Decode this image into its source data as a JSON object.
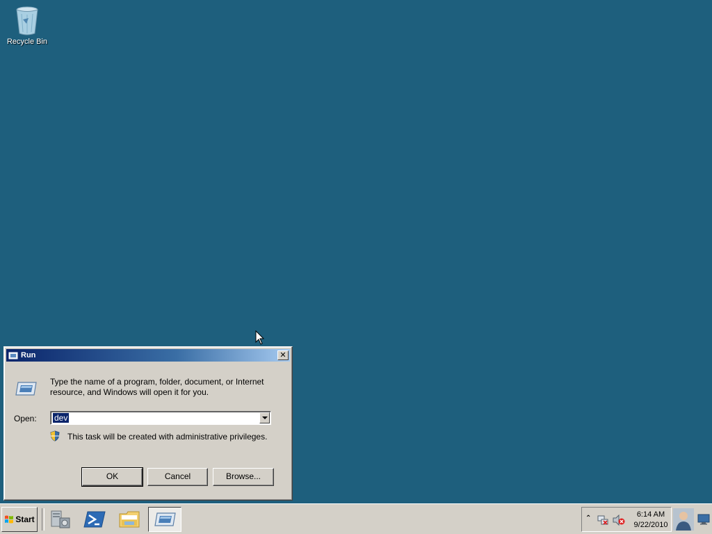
{
  "desktop": {
    "icons": [
      {
        "label": "Recycle Bin",
        "icon": "recycle-bin-icon"
      }
    ],
    "background_color": "#1e5f7d"
  },
  "run_dialog": {
    "title": "Run",
    "description": "Type the name of a program, folder, document, or Internet resource, and Windows will open it for you.",
    "open_label": "Open:",
    "open_value": "dev",
    "admin_note": "This task will be created with administrative privileges.",
    "buttons": {
      "ok": "OK",
      "cancel": "Cancel",
      "browse": "Browse..."
    }
  },
  "taskbar": {
    "start_label": "Start",
    "quick_launch": [
      "server-manager-icon",
      "powershell-icon",
      "explorer-icon"
    ],
    "active_task_icon": "run-icon",
    "clock": {
      "time": "6:14 AM",
      "date": "9/22/2010"
    }
  }
}
